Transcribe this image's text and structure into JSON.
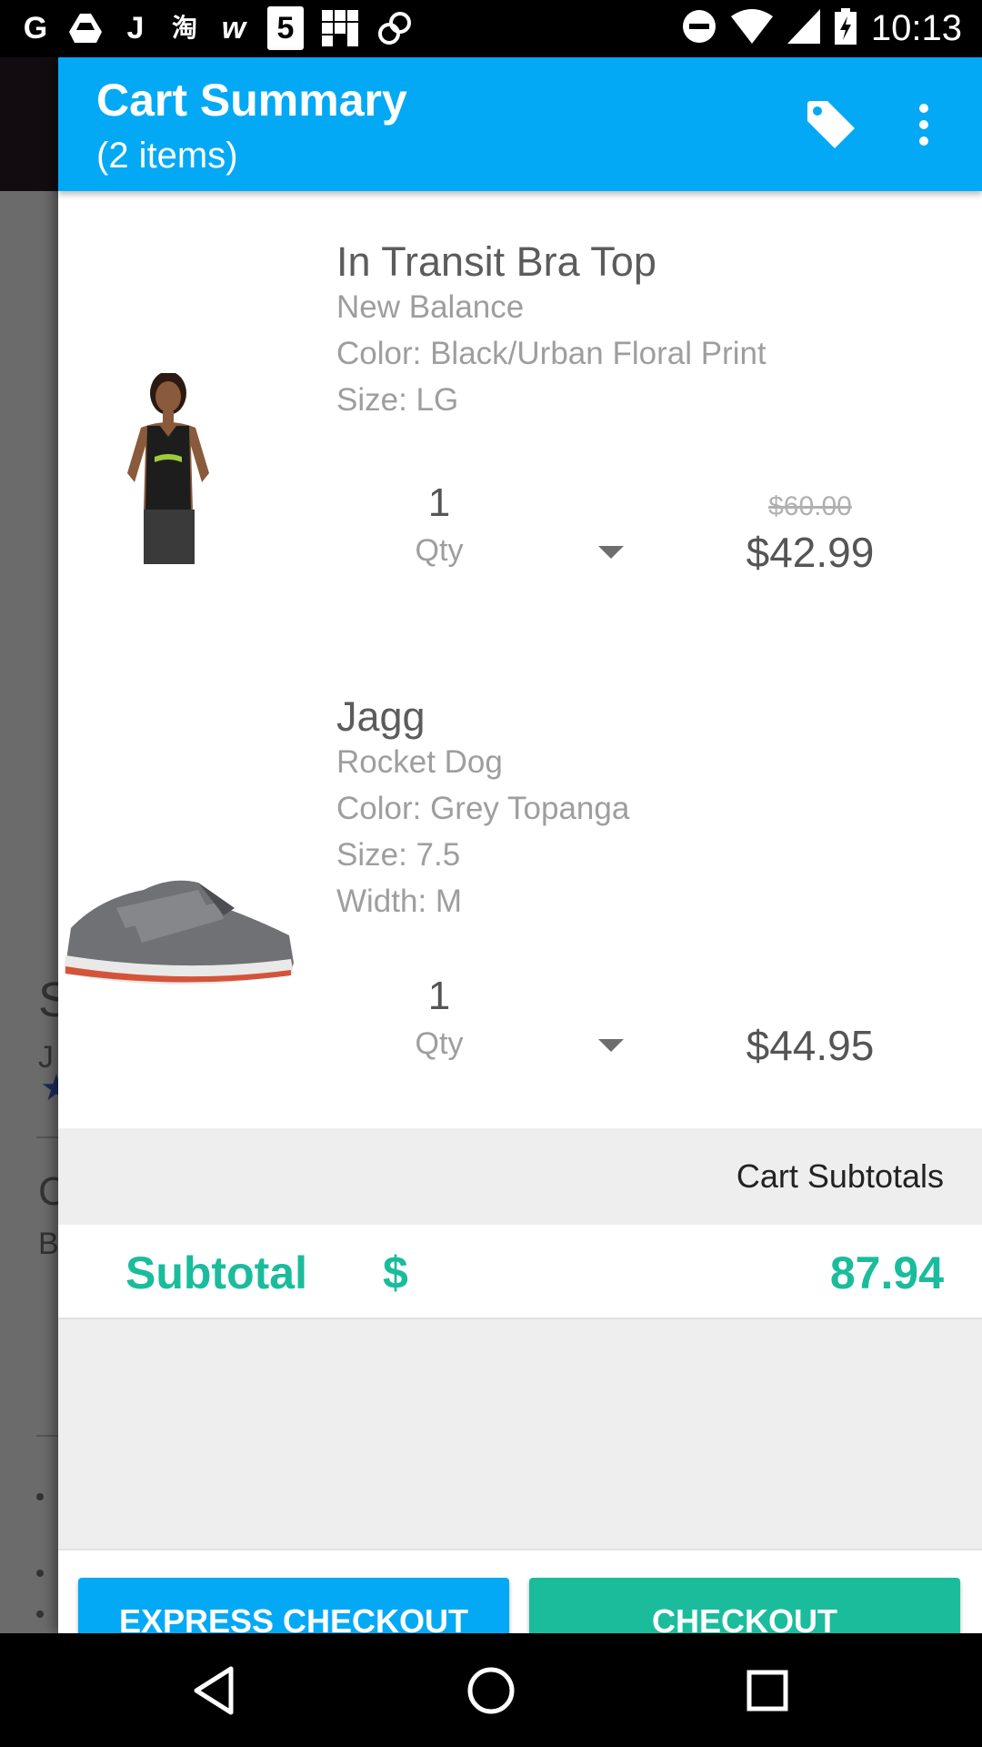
{
  "status_bar": {
    "left_icons": [
      "G",
      "drive",
      "J",
      "淘",
      "w",
      "5",
      "grid",
      "link"
    ],
    "time": "10:13"
  },
  "header": {
    "title": "Cart Summary",
    "subtitle": "(2 items)",
    "tag_icon": "tag-icon",
    "more_icon": "more-vert-icon"
  },
  "items": [
    {
      "name": "In Transit Bra Top",
      "brand": "New Balance",
      "color": "Color: Black/Urban Floral Print",
      "size": "Size: LG",
      "qty": "1",
      "qty_label": "Qty",
      "original_price": "$60.00",
      "price": "$42.99"
    },
    {
      "name": "Jagg",
      "brand": "Rocket Dog",
      "color": "Color: Grey Topanga",
      "size": "Size: 7.5",
      "width": "Width: M",
      "qty": "1",
      "qty_label": "Qty",
      "price": "$44.95"
    }
  ],
  "subtotals": {
    "heading": "Cart Subtotals",
    "label": "Subtotal",
    "currency": "$",
    "amount": "87.94"
  },
  "buttons": {
    "express_checkout": "EXPRESS CHECKOUT",
    "checkout": "CHECKOUT"
  },
  "colors": {
    "primary": "#03a9f4",
    "accent": "#1abc9c"
  }
}
